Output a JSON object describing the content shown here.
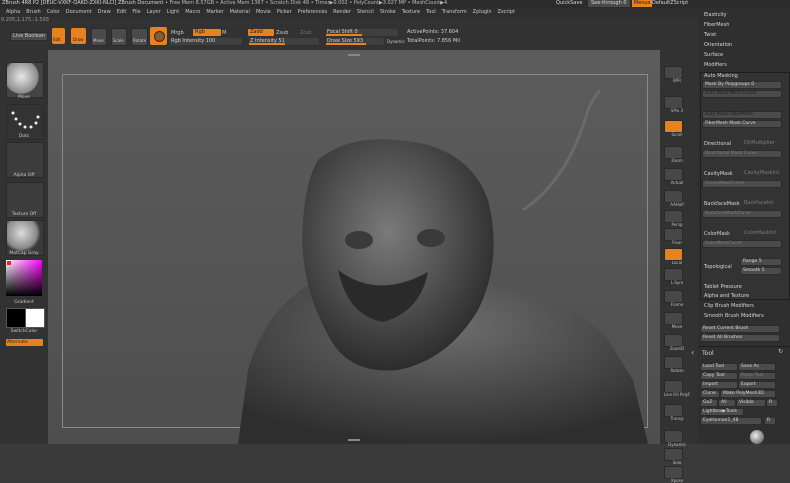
{
  "titlebar": {
    "title": "ZBrush 4R8 P2 [DEUC-VXKF-QAKD-ZXKI-NLCI]  ZBrush Document",
    "stats": "• Free Mem 8.57GB • Active Mem 1367 • Scratch Disk 48 • Timer▶0.002 • PolyCount▶3.027 MP • MeshCount▶4",
    "quicksave": "QuickSave",
    "seethrough": "See-through  0",
    "menus_button": "Menus",
    "defaultzscript": "DefaultZScript"
  },
  "menubar": {
    "items": [
      "Alpha",
      "Brush",
      "Color",
      "Document",
      "Draw",
      "Edit",
      "File",
      "Layer",
      "Light",
      "Macro",
      "Marker",
      "Material",
      "Movie",
      "Picker",
      "Preferences",
      "Render",
      "Stencil",
      "Stroke",
      "Texture",
      "Tool",
      "Transform",
      "Zplugin",
      "Zscript"
    ]
  },
  "coords": "0.205,1.175,-1.593",
  "topshelf": {
    "live_boolean": "Live Boolean",
    "edit": "Edit",
    "draw": "Draw",
    "move": "Move",
    "scale": "Scale",
    "rotate": "Rotate",
    "mrgb": "Mrgb",
    "rgb": "Rgb",
    "m": "M",
    "rgb_intensity": "Rgb Intensity 100",
    "zadd": "Zadd",
    "zsub": "Zsub",
    "zcut": "Zcut",
    "z_intensity": "Z Intensity 51",
    "focal_shift": "Focal Shift 0",
    "draw_size": "Draw Size 593",
    "dynamic": "Dynamic",
    "active_points": "ActivePoints: 37.604",
    "total_points": "TotalPoints: 7.856 Mil"
  },
  "leftshelf": {
    "brush": "Move",
    "stroke": "Dots",
    "alpha": "Alpha Off",
    "texture": "Texture Off",
    "material": "MatCap Gray",
    "gradient": "Gradient",
    "switchcolor": "SwitchColor",
    "alternate": "Alternate"
  },
  "rightshelf": {
    "items": [
      "BPR",
      "SPix 3",
      "Scroll",
      "Zoom",
      "Actual",
      "AAHalf",
      "Persp",
      "Floor",
      "Local",
      "L.Sym",
      "Frame",
      "Move",
      "ZoomD",
      "Rotate",
      "Line Fill PolyF",
      "Transp",
      "Dynamic",
      "Solo",
      "Xpose"
    ]
  },
  "rightpanel": {
    "top_items": [
      "Elasticity",
      "FiberMesh",
      "Twist",
      "Orientation",
      "Surface",
      "Modifiers"
    ],
    "auto_masking": "Auto Masking",
    "mask_by_polygroups": "Mask By Polygroups 0",
    "auto_mask_mesh_insert": "Auto Mask Mesh Insert",
    "auto_mask_fibermesh": "Auto Mask FiberMesh",
    "fibermesh_mask_curve": "FiberMesh Mask Curve",
    "directional": "Directional",
    "dir_multiplier": "DirMultiplier",
    "directional_mask_curve": "Directional Mask Curve",
    "cavity_mask": "CavityMask",
    "cavity_mask_int": "CavityMaskInt",
    "cavity_mask_curve": "CavityMaskCurve",
    "backface_mask": "BackfaceMask",
    "backface_mask_int": "BackfaceInt",
    "backface_mask_curve": "BackfaceMaskCurve",
    "color_mask": "ColorMask",
    "color_mask_int": "ColorMaskInt",
    "color_mask_curve": "ColorMaskCurve",
    "topological": "Topological",
    "range": "Range 5",
    "smooth": "Smooth 5",
    "tablet_pressure": "Tablet Pressure",
    "alpha_and_texture": "Alpha and Texture",
    "clip_brush_modifiers": "Clip Brush Modifiers",
    "smooth_brush_modifiers": "Smooth Brush Modifiers",
    "reset_current_brush": "Reset Current Brush",
    "reset_all_brushes": "Reset All Brushes",
    "tool": "Tool",
    "load_tool": "Load Tool",
    "save_as": "Save As",
    "copy_tool": "Copy Tool",
    "paste_tool": "Paste Tool",
    "import": "Import",
    "export": "Export",
    "clone": "Clone",
    "make_polymesh3d": "Make PolyMesh3D",
    "goz": "GoZ",
    "all": "All",
    "visible": "Visible",
    "r": "R",
    "lightbox_tools": "Lightbox▶Tools",
    "eye_human": "EyeHuman1_48",
    "r2": "R"
  }
}
